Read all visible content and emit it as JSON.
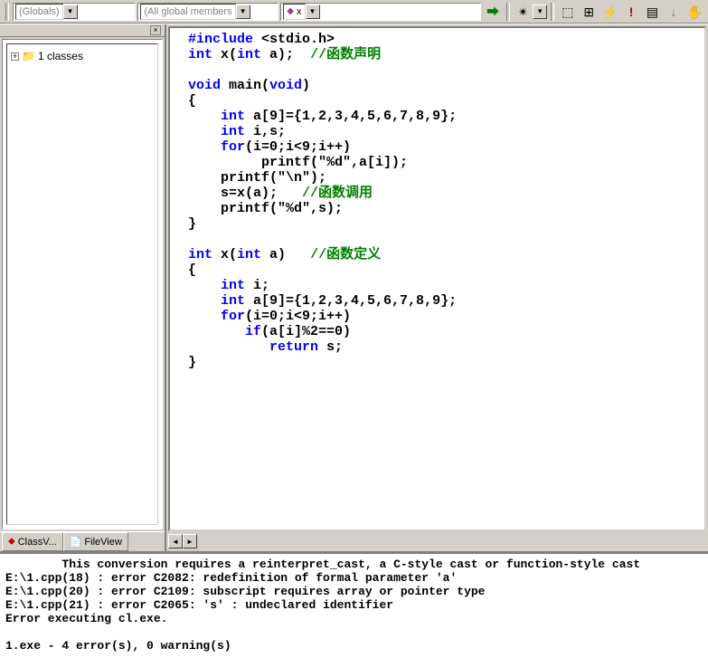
{
  "toolbar": {
    "combo1": "(Globals)",
    "combo2": "(All global members",
    "combo3_icon": "◆",
    "combo3_text": "x",
    "icons": {
      "go": "⮕",
      "wand": "✴",
      "bp_hand": "🖐",
      "stack": "⬚",
      "registers": "⊞",
      "disasm": "⚡",
      "excl": "!",
      "bookmark": "▤",
      "step": "↓",
      "hand": "✋"
    }
  },
  "sidebar": {
    "close_tip": "×",
    "tree_root": "1 classes",
    "tabs": {
      "classview": "ClassV...",
      "fileview": "FileView"
    }
  },
  "code": {
    "l1_a": "#include",
    "l1_b": " <stdio.h>",
    "l2_a": "int",
    "l2_b": " x(",
    "l2_c": "int",
    "l2_d": " a);  ",
    "l2_e": "//函数声明",
    "l4_a": "void",
    "l4_b": " main(",
    "l4_c": "void",
    "l4_d": ")",
    "l5": "{",
    "l6_a": "    ",
    "l6_b": "int",
    "l6_c": " a[9]={1,2,3,4,5,6,7,8,9};",
    "l7_a": "    ",
    "l7_b": "int",
    "l7_c": " i,s;",
    "l8_a": "    ",
    "l8_b": "for",
    "l8_c": "(i=0;i<9;i++)",
    "l9": "         printf(\"%d\",a[i]);",
    "l10": "    printf(\"\\n\");",
    "l11_a": "    s=x(a);   ",
    "l11_b": "//函数调用",
    "l12": "    printf(\"%d\",s);",
    "l13": "}",
    "l15_a": "int",
    "l15_b": " x(",
    "l15_c": "int",
    "l15_d": " a)   ",
    "l15_e": "//函数定义",
    "l16": "{",
    "l17_a": "    ",
    "l17_b": "int",
    "l17_c": " i;",
    "l18_a": "    ",
    "l18_b": "int",
    "l18_c": " a[9]={1,2,3,4,5,6,7,8,9};",
    "l19_a": "    ",
    "l19_b": "for",
    "l19_c": "(i=0;i<9;i++)",
    "l20_a": "       ",
    "l20_b": "if",
    "l20_c": "(a[i]%2==0)",
    "l21_a": "          ",
    "l21_b": "return",
    "l21_c": " s;",
    "l22": "}"
  },
  "output": {
    "l1": "        This conversion requires a reinterpret_cast, a C-style cast or function-style cast",
    "l2": "E:\\1.cpp(18) : error C2082: redefinition of formal parameter 'a'",
    "l3": "E:\\1.cpp(20) : error C2109: subscript requires array or pointer type",
    "l4": "E:\\1.cpp(21) : error C2065: 's' : undeclared identifier",
    "l5": "Error executing cl.exe.",
    "l6": "",
    "l7": "1.exe - 4 error(s), 0 warning(s)"
  }
}
